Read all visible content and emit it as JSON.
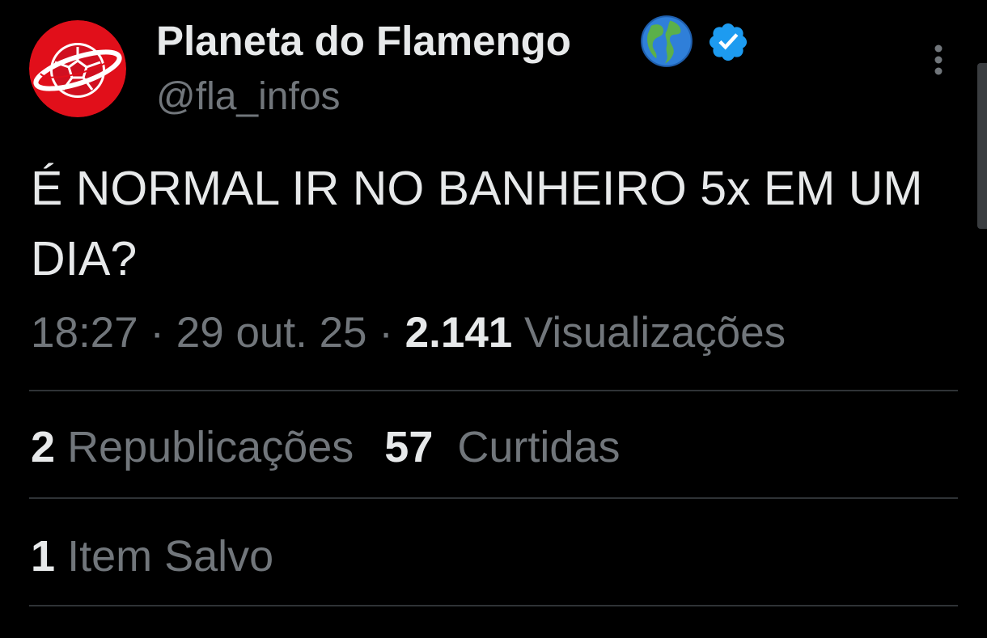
{
  "author": {
    "display_name": "Planeta do Flamengo",
    "handle": "@fla_infos",
    "avatar": "red-planet-ball-logo",
    "badges": [
      "globe-icon",
      "verified-icon"
    ]
  },
  "tweet": {
    "text": "É NORMAL IR NO BANHEIRO 5x EM UM DIA?",
    "time": "18:27",
    "date": "29 out. 25",
    "separator": "·",
    "views_count": "2.141",
    "views_label": "Visualizações"
  },
  "stats": {
    "reposts_count": "2",
    "reposts_label": "Republicações",
    "likes_count": "57",
    "likes_label": "Curtidas",
    "saved_count": "1",
    "saved_label": "Item Salvo"
  },
  "colors": {
    "background": "#000000",
    "primary_text": "#e7e9ea",
    "secondary_text": "#71767b",
    "verified": "#1d9bf0",
    "divider": "#2f3336"
  }
}
